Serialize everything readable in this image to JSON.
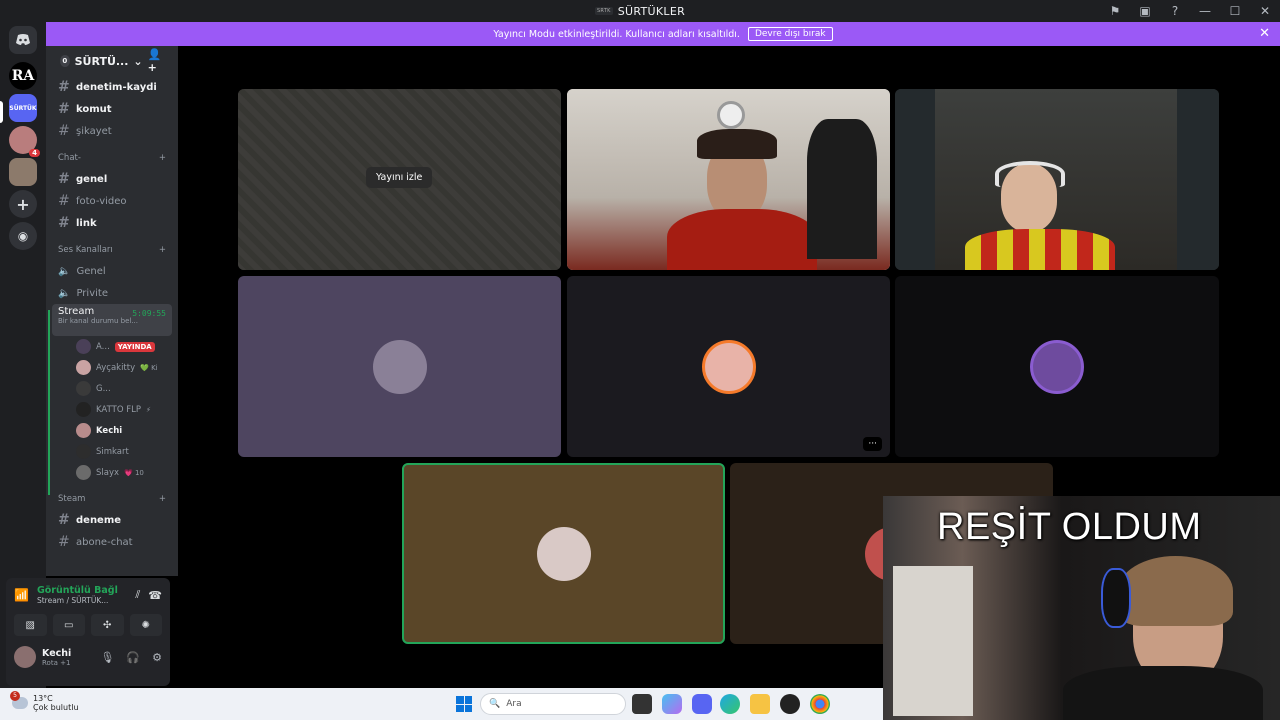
{
  "window": {
    "title": "SÜRTÜKLER",
    "server_mini": "SRTK"
  },
  "banner": {
    "message": "Yayıncı Modu etkinleştirildi. Kullanıcı adları kısaltıldı.",
    "button": "Devre dışı bırak"
  },
  "rail": {
    "ra_label": "RA",
    "surtuk_label": "SÜRTÜK",
    "mention_count": "4"
  },
  "server": {
    "name": "SÜRTÜ...",
    "boost": "0"
  },
  "channels_top": [
    {
      "name": "denetim-kaydi",
      "unread": true
    },
    {
      "name": "komut",
      "unread": true
    },
    {
      "name": "şikayet",
      "unread": false
    }
  ],
  "category_chat": "Chat-",
  "channels_chat": [
    {
      "name": "genel",
      "unread": true
    },
    {
      "name": "foto-video",
      "unread": false
    },
    {
      "name": "link",
      "unread": true
    }
  ],
  "category_voice": "Ses Kanalları",
  "voice_channels": [
    {
      "name": "Genel"
    },
    {
      "name": "Privite"
    }
  ],
  "stream_channel": {
    "name": "Stream",
    "status": "Bir kanal durumu bel...",
    "timer": "5:09:55"
  },
  "members": [
    {
      "name": "A...",
      "badge": "YAYINDA",
      "color": "#4a4058"
    },
    {
      "name": "Ayçakitty",
      "badge": "",
      "extra": "💚 Ki",
      "color": "#c9a3a3"
    },
    {
      "name": "G...",
      "badge": "",
      "color": "#3a3a3a"
    },
    {
      "name": "KATTO FLP",
      "badge": "",
      "extra": "⚡",
      "color": "#222"
    },
    {
      "name": "Kechi",
      "badge": "",
      "color": "#b88c8c",
      "active": true
    },
    {
      "name": "Simkart",
      "badge": "",
      "color": "#2d2d2d"
    },
    {
      "name": "Slayx",
      "badge": "",
      "extra": "💗 10",
      "color": "#6b6b6b"
    }
  ],
  "category_steam": "Steam",
  "channels_steam": [
    {
      "name": "deneme",
      "unread": true
    },
    {
      "name": "abone-chat",
      "unread": false
    }
  ],
  "voice_status": {
    "title": "Görüntülü Bağl",
    "subtitle": "Stream / SÜRTÜK..."
  },
  "user": {
    "name": "Kechi",
    "status": "Rota +1"
  },
  "stage": {
    "watch_label": "Yayını izle",
    "more_label": "···",
    "tiles": [
      {
        "kind": "stream",
        "bg": "#3b3a37"
      },
      {
        "kind": "cam1",
        "bg": "#c8c3bd"
      },
      {
        "kind": "cam2",
        "bg": "#2a2f33"
      },
      {
        "kind": "avatar",
        "bg": "#4e4560",
        "avatar": "#8a8097"
      },
      {
        "kind": "avatar",
        "bg": "#1b1a1f",
        "avatar": "#e8b3a8"
      },
      {
        "kind": "avatar",
        "bg": "#0d0d0f",
        "avatar": "#6e4b9e"
      },
      {
        "kind": "avatar",
        "bg": "#5a4628",
        "avatar": "#d9c9c6",
        "speaking": true
      },
      {
        "kind": "avatar",
        "bg": "#2b2118",
        "avatar": "#c0504d"
      }
    ]
  },
  "taskbar": {
    "temp": "13°C",
    "weather": "Çok bulutlu",
    "weather_badge": "5",
    "search_placeholder": "Ara"
  },
  "overlay": {
    "caption": "REŞİT OLDUM"
  }
}
